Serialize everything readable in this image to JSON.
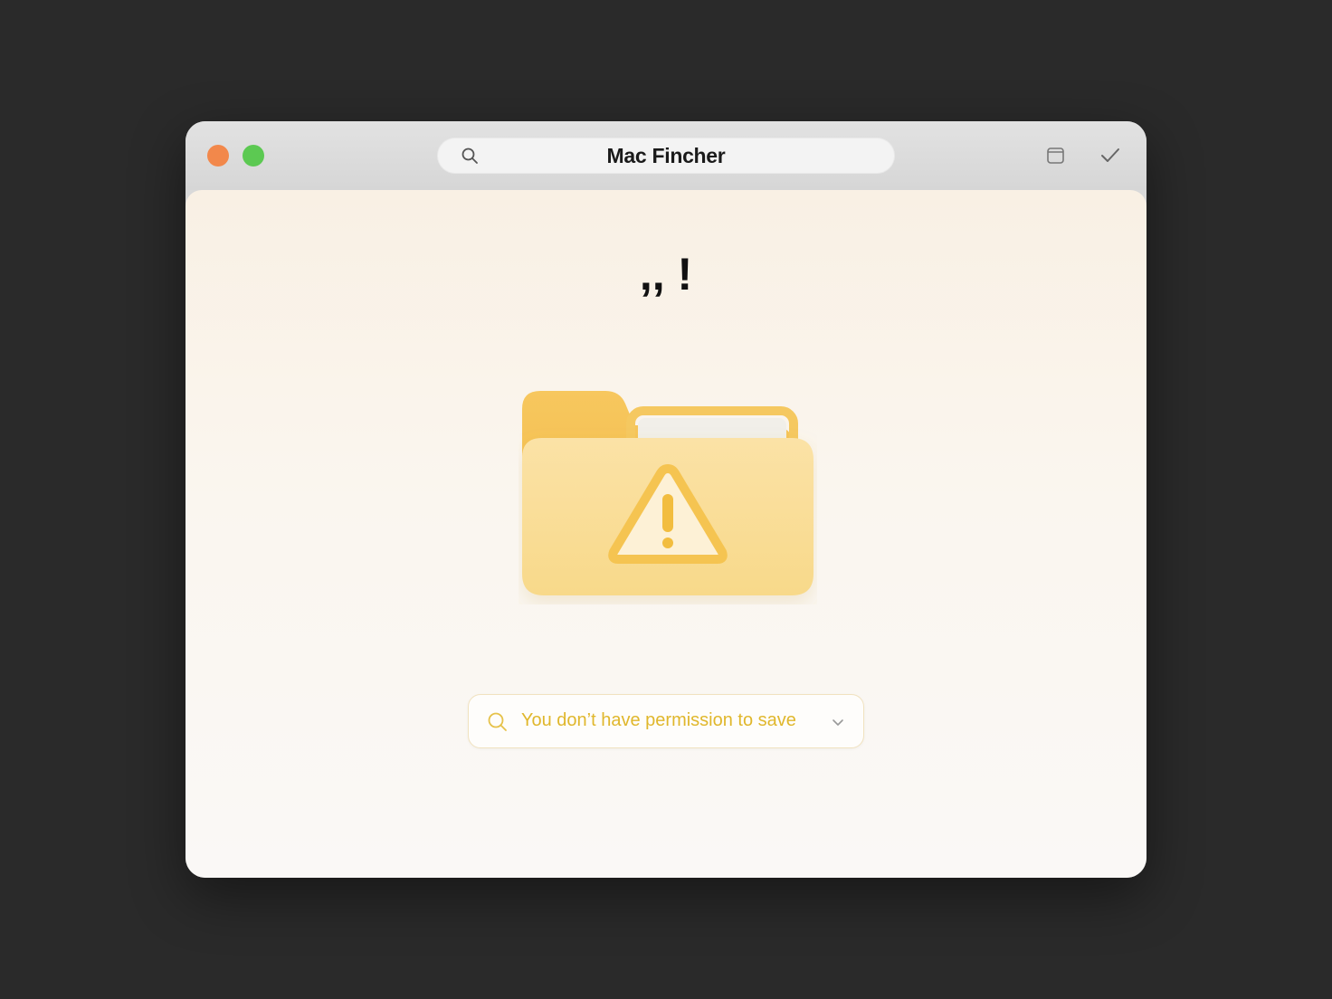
{
  "window": {
    "title": "Mac Fincher",
    "controls": [
      "close",
      "zoom"
    ],
    "toolbar_icons": [
      "sidebar-icon",
      "checkmark-icon"
    ]
  },
  "content": {
    "headline": ",, !",
    "illustration": "folder-warning-icon",
    "message": {
      "text": "You don’t have permission to save",
      "icon": "search-icon",
      "dropdown_icon": "chevron-down-icon"
    }
  },
  "colors": {
    "background": "#2a2a2a",
    "titlebar": "#d9d9d9",
    "close": "#f2884b",
    "zoom": "#5cc952",
    "accent": "#e0b72c",
    "folder": "#f9d97e"
  }
}
